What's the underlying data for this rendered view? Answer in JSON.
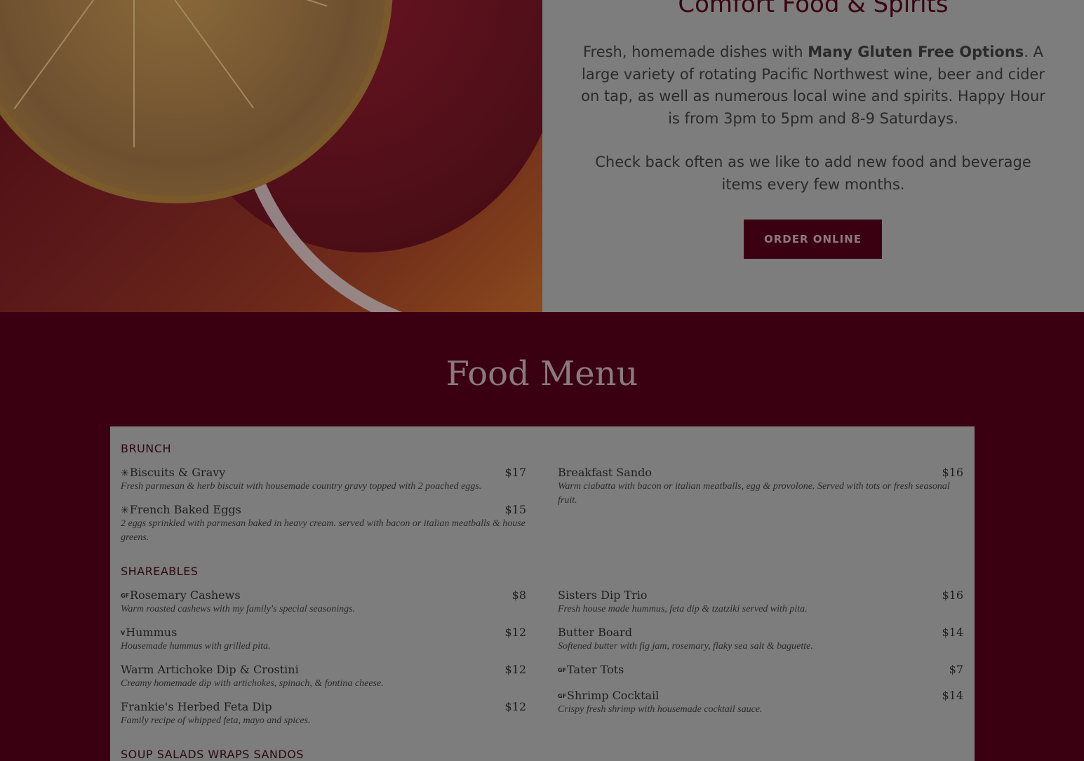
{
  "hero": {
    "title": "Comfort Food & Spirits",
    "p1_pre": "Fresh, homemade dishes with ",
    "p1_bold": "Many Gluten Free Options",
    "p1_post": ". A large variety of rotating Pacific Northwest wine, beer and cider on tap, as well as numerous local wine and spirits. Happy Hour is from 3pm to 5pm and 8-9 Saturdays.",
    "p2": "Check back often as we like to add new food and beverage items every few months.",
    "order_label": "ORDER ONLINE"
  },
  "menu": {
    "title": "Food Menu",
    "categories": [
      {
        "name": "BRUNCH"
      },
      {
        "name": "SHAREABLES"
      },
      {
        "name": "SOUP SALADS WRAPS SANDOS"
      }
    ],
    "brunch_left": [
      {
        "icon": "✳",
        "name": "Biscuits & Gravy",
        "price": "$17",
        "desc": "Fresh parmesan & herb biscuit with housemade country gravy topped with 2 poached eggs."
      },
      {
        "icon": "✳",
        "name": "French Baked Eggs",
        "price": "$15",
        "desc": "2 eggs sprinkled with parmesan baked in heavy cream. served with bacon or italian meatballs & house greens."
      }
    ],
    "brunch_right": [
      {
        "icon": "",
        "name": "Breakfast Sando",
        "price": "$16",
        "desc": "Warm ciabatta with bacon or italian meatballs, egg & provolone. Served with tots or fresh seasonal fruit."
      }
    ],
    "share_left": [
      {
        "icon": "GF",
        "name": "Rosemary Cashews",
        "price": "$8",
        "desc": "Warm roasted cashews with my family's special seasonings."
      },
      {
        "icon": "V",
        "name": "Hummus",
        "price": "$12",
        "desc": "Housemade hummus with grilled pita."
      },
      {
        "icon": "",
        "name": "Warm Artichoke Dip & Crostini",
        "price": "$12",
        "desc": "Creamy homemade dip with artichokes, spinach, & fontina cheese."
      },
      {
        "icon": "",
        "name": "Frankie's Herbed Feta Dip",
        "price": "$12",
        "desc": "Family recipe of whipped feta, mayo and spices."
      }
    ],
    "share_right": [
      {
        "icon": "",
        "name": "Sisters Dip Trio",
        "price": "$16",
        "desc": "Fresh house made hummus, feta dip & tzatziki served with pita."
      },
      {
        "icon": "",
        "name": "Butter Board",
        "price": "$14",
        "desc": "Softened butter with fig jam, rosemary, flaky sea salt & baguette."
      },
      {
        "icon": "GF",
        "name": "Tater Tots",
        "price": "$7",
        "desc": ""
      },
      {
        "icon": "GF",
        "name": "Shrimp Cocktail",
        "price": "$14",
        "desc": "Crispy fresh shrimp with housemade cocktail sauce."
      }
    ]
  }
}
